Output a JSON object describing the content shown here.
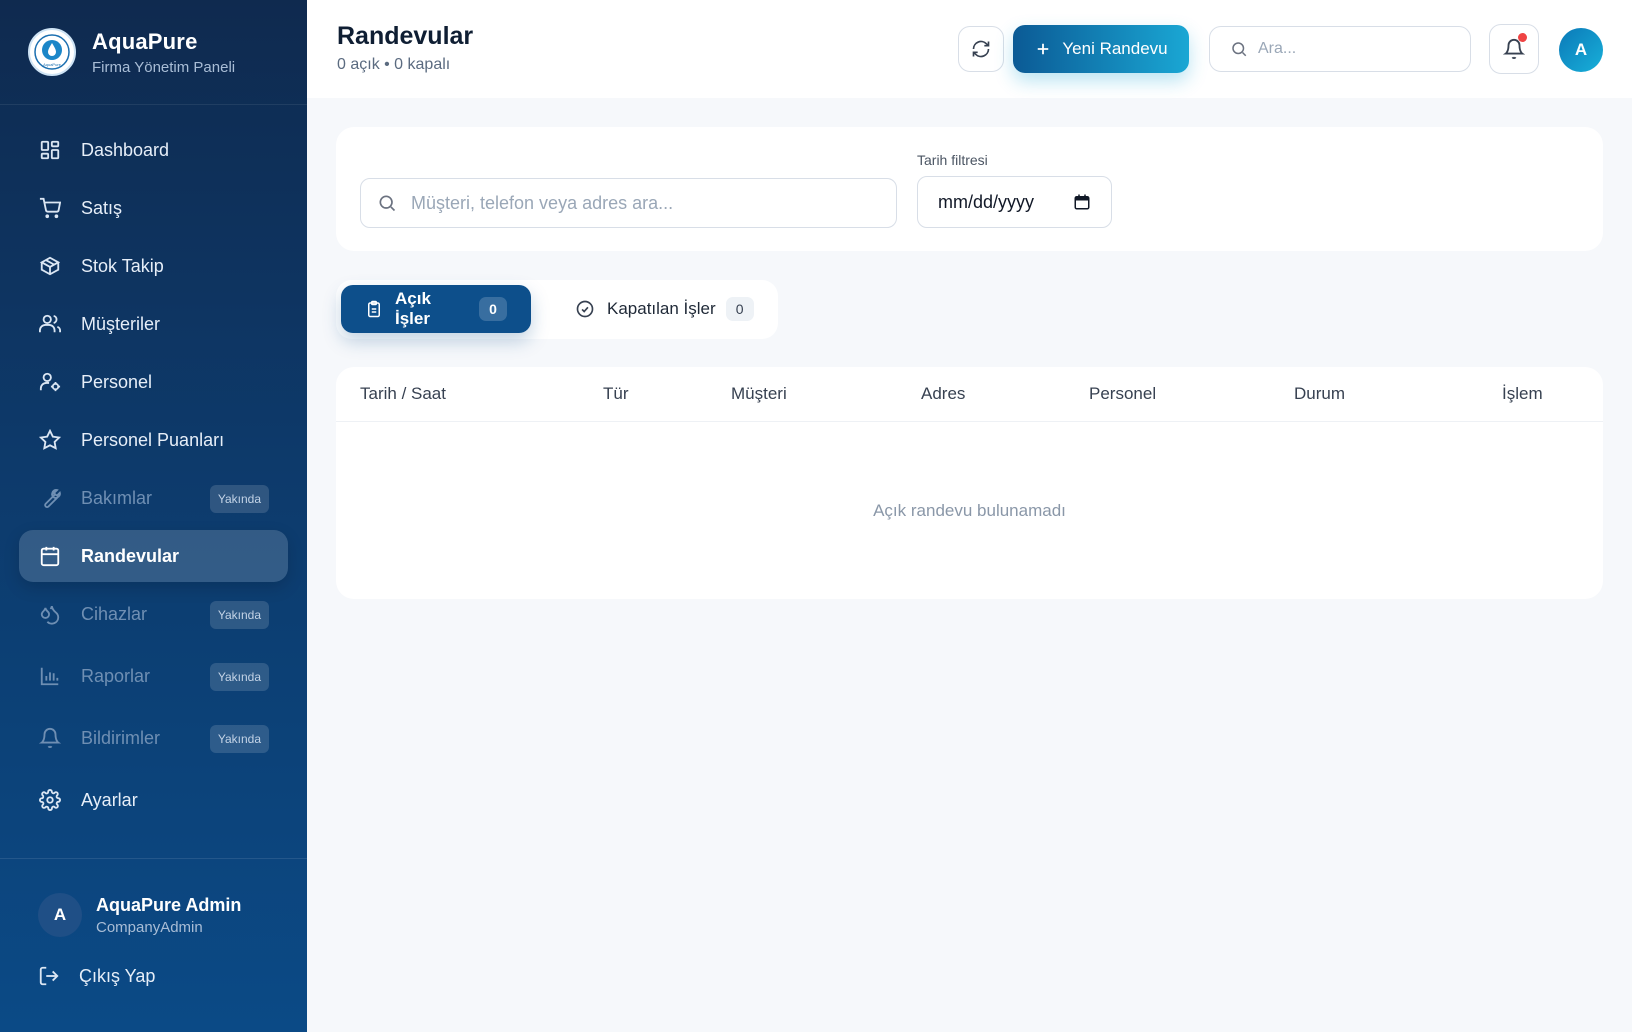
{
  "brand": {
    "name": "AquaPure",
    "subtitle": "Firma Yönetim Paneli",
    "logo_text": "AquaPure"
  },
  "sidebar": {
    "items": [
      {
        "label": "Dashboard",
        "icon": "dashboard-icon",
        "state": "normal"
      },
      {
        "label": "Satış",
        "icon": "cart-icon",
        "state": "normal"
      },
      {
        "label": "Stok Takip",
        "icon": "package-icon",
        "state": "normal"
      },
      {
        "label": "Müşteriler",
        "icon": "users-icon",
        "state": "normal"
      },
      {
        "label": "Personel",
        "icon": "user-cog-icon",
        "state": "normal"
      },
      {
        "label": "Personel Puanları",
        "icon": "star-icon",
        "state": "normal"
      },
      {
        "label": "Bakımlar",
        "icon": "wrench-icon",
        "state": "disabled",
        "badge": "Yakında"
      },
      {
        "label": "Randevular",
        "icon": "calendar-icon",
        "state": "active"
      },
      {
        "label": "Cihazlar",
        "icon": "droplets-icon",
        "state": "disabled",
        "badge": "Yakında"
      },
      {
        "label": "Raporlar",
        "icon": "bar-chart-icon",
        "state": "disabled",
        "badge": "Yakında"
      },
      {
        "label": "Bildirimler",
        "icon": "bell-icon",
        "state": "disabled",
        "badge": "Yakında"
      },
      {
        "label": "Ayarlar",
        "icon": "settings-icon",
        "state": "normal"
      }
    ],
    "user": {
      "initial": "A",
      "name": "AquaPure Admin",
      "role": "CompanyAdmin"
    },
    "logout_label": "Çıkış Yap"
  },
  "header": {
    "title": "Randevular",
    "subtitle": "0 açık • 0 kapalı",
    "new_button_label": "Yeni Randevu",
    "search_placeholder": "Ara...",
    "avatar_initial": "A"
  },
  "filters": {
    "search_placeholder": "Müşteri, telefon veya adres ara...",
    "date_label": "Tarih filtresi",
    "date_placeholder": "mm/dd/yyyy"
  },
  "tabs": [
    {
      "label": "Açık İşler",
      "count": "0",
      "active": true
    },
    {
      "label": "Kapatılan İşler",
      "count": "0",
      "active": false
    }
  ],
  "table": {
    "columns": [
      "Tarih / Saat",
      "Tür",
      "Müşteri",
      "Adres",
      "Personel",
      "Durum",
      "İşlem"
    ],
    "empty_message": "Açık randevu bulunamadı"
  },
  "colors": {
    "sidebar_top": "#0f2a4f",
    "sidebar_bottom": "#0b4a86",
    "accent": "#0d4f8b",
    "accent_gradient_end": "#1aa7d4",
    "notification_dot": "#ef4444"
  }
}
